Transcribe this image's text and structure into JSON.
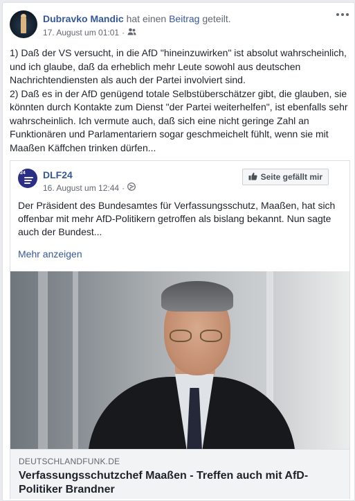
{
  "post": {
    "author": "Dubravko Mandic",
    "action_prefix": "hat einen",
    "action_link": "Beitrag",
    "action_suffix": "geteilt.",
    "timestamp": "17. August um 01:01",
    "separator": "·",
    "audience_icon": "friends-icon",
    "menu_icon": "more-options-icon",
    "paragraph_1": "1) Daß der VS versucht, in die AfD \"hineinzuwirken\" ist absolut wahrscheinlich, und ich glaube, daß da erheblich mehr Leute sowohl aus deutschen Nachrichtendiensten als auch der Partei involviert sind.",
    "paragraph_2": "2) Daß es in der AfD genügend totale Selbstüberschätzer gibt, die glauben, sie könnten durch Kontakte zum Dienst \"der Partei weiterhelfen\", ist ebenfalls sehr wahrscheinlich. Ich vermute auch, daß sich eine nicht geringe Zahl an Funktionären und Parlamentariern sogar geschmeichelt fühlt, wenn sie mit Maaßen Käffchen trinken dürfen..."
  },
  "shared": {
    "page_name": "DLF24",
    "avatar_label": "24",
    "timestamp": "16. August um 12:44",
    "separator": "·",
    "audience_icon": "globe-icon",
    "like_button_label": "Seite gefällt mir",
    "like_icon": "thumbs-up-icon",
    "excerpt": "Der Präsident des Bundesamtes für Verfassungsschutz, Maaßen, hat sich offenbar mit mehr AfD-Politikern getroffen als bislang bekannt. Nun sagte auch der Bundest...",
    "more_label": "Mehr anzeigen",
    "link": {
      "domain": "DEUTSCHLANDFUNK.DE",
      "headline": "Verfassungsschutzchef Maaßen - Treffen auch mit AfD-Politiker Brandner"
    }
  },
  "colors": {
    "link": "#365899",
    "text": "#1d2129",
    "muted": "#616770",
    "dlf_blue": "#2b2e85"
  }
}
